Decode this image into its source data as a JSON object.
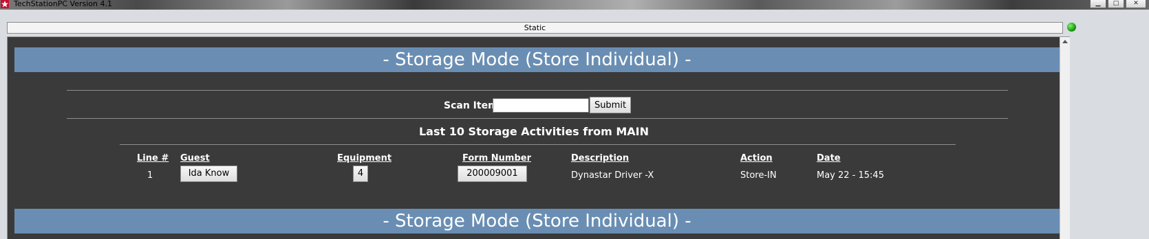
{
  "window": {
    "title": "TechStationPC Version 4.1",
    "minimize_glyph": "▁",
    "maximize_glyph": "□",
    "close_glyph": "✕"
  },
  "status_bar": {
    "label": "Static",
    "indicator_color": "#1c9a10"
  },
  "banner": {
    "title": "- Storage Mode (Store Individual) -",
    "color": "#6a8eb3"
  },
  "scan": {
    "label": "Scan Item:",
    "input_value": "",
    "submit_label": "Submit"
  },
  "activities": {
    "title": "Last 10 Storage Activities from MAIN",
    "columns": [
      "Line #",
      "Guest",
      "Equipment",
      "Form Number",
      "Description",
      "Action",
      "Date"
    ],
    "rows": [
      {
        "line": "1",
        "guest": "Ida Know",
        "equipment": "4",
        "form_number": "200009001",
        "description": "Dynastar Driver -X",
        "action": "Store-IN",
        "date": "May 22 - 15:45"
      }
    ]
  },
  "icons": {
    "app": "star-logo-icon",
    "status": "green-status-dot-icon",
    "scroll_up": "scroll-up-arrow-icon"
  }
}
